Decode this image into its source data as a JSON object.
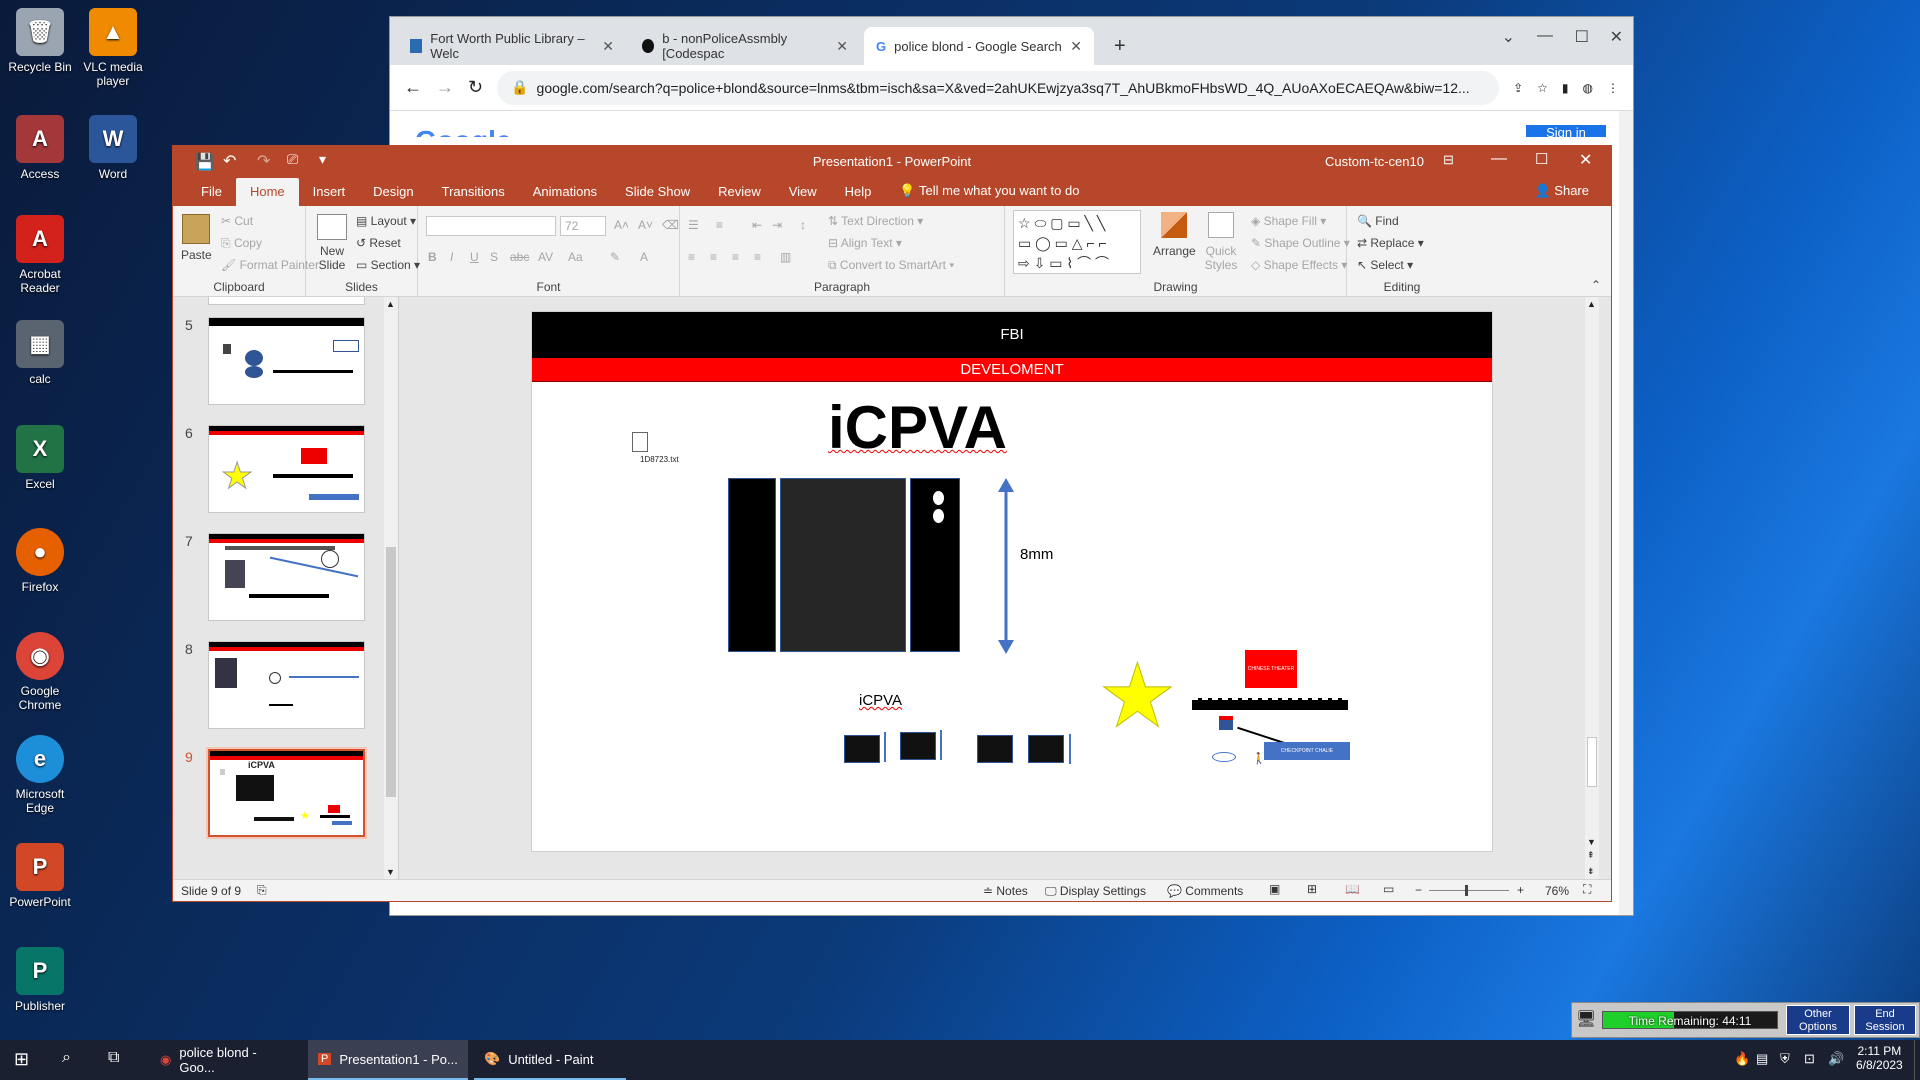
{
  "desktop": {
    "icons": [
      {
        "label": "Recycle Bin"
      },
      {
        "label": "VLC media player"
      },
      {
        "label": "Access"
      },
      {
        "label": "Word"
      },
      {
        "label": "Acrobat Reader"
      },
      {
        "label": "calc"
      },
      {
        "label": "Excel"
      },
      {
        "label": "Firefox"
      },
      {
        "label": "Google Chrome"
      },
      {
        "label": "Microsoft Edge"
      },
      {
        "label": "PowerPoint"
      },
      {
        "label": "Publisher"
      }
    ]
  },
  "chrome": {
    "tabs": [
      {
        "title": "Fort Worth Public Library – Welc"
      },
      {
        "title": "b - nonPoliceAssmbly [Codespac"
      },
      {
        "title": "police blond - Google Search"
      }
    ],
    "url": "google.com/search?q=police+blond&source=lnms&tbm=isch&sa=X&ved=2ahUKEwjzya3sq7T_AhUBkmoFHbsWD_4Q_AUoAXoECAEQAw&biw=12...",
    "google_logo": "Google",
    "signin": "Sign in"
  },
  "ppt": {
    "title": "Presentation1  -  PowerPoint",
    "user": "Custom-tc-cen10",
    "menu": [
      "File",
      "Home",
      "Insert",
      "Design",
      "Transitions",
      "Animations",
      "Slide Show",
      "Review",
      "View",
      "Help"
    ],
    "tell_me": "Tell me what you want to do",
    "share": "Share",
    "ribbon": {
      "clipboard": {
        "label": "Clipboard",
        "paste": "Paste",
        "cut": "Cut",
        "copy": "Copy",
        "format_painter": "Format Painter"
      },
      "slides": {
        "label": "Slides",
        "new_slide": "New Slide",
        "layout": "Layout",
        "reset": "Reset",
        "section": "Section"
      },
      "font": {
        "label": "Font",
        "size": "72"
      },
      "paragraph": {
        "label": "Paragraph",
        "text_direction": "Text Direction",
        "align_text": "Align Text",
        "convert": "Convert to SmartArt"
      },
      "drawing": {
        "label": "Drawing",
        "arrange": "Arrange",
        "quick_styles": "Quick Styles",
        "shape_fill": "Shape Fill",
        "shape_outline": "Shape Outline",
        "shape_effects": "Shape Effects"
      },
      "editing": {
        "label": "Editing",
        "find": "Find",
        "replace": "Replace",
        "select": "Select"
      }
    },
    "thumbnails": [
      "5",
      "6",
      "7",
      "8",
      "9"
    ],
    "slide": {
      "header": "FBI",
      "subheader": "DEVELOMENT",
      "title": "iCPVA",
      "file_icon_label": "1D8723.txt",
      "dimension_label": "8mm",
      "small_title": "iCPVA",
      "red_box_label": "CHINESE THEATER",
      "blue_box_label": "CHECKPOINT CHALIE"
    },
    "status": {
      "slide_of": "Slide 9 of 9",
      "notes": "Notes",
      "display_settings": "Display Settings",
      "comments": "Comments",
      "zoom": "76%"
    }
  },
  "taskbar": {
    "apps": [
      {
        "label": "police blond - Goo..."
      },
      {
        "label": "Presentation1 - Po..."
      },
      {
        "label": "Untitled - Paint"
      }
    ],
    "time": "2:11 PM",
    "date": "6/8/2023"
  },
  "session": {
    "time_remaining": "Time Remaining: 44:11",
    "other_options": "Other Options",
    "end_session": "End Session"
  },
  "colors": {
    "ppt_accent": "#b7472a",
    "fbi_black": "#000000",
    "dev_red": "#ff0000",
    "star_yellow": "#ffff00",
    "arrow_blue": "#4472c4"
  }
}
